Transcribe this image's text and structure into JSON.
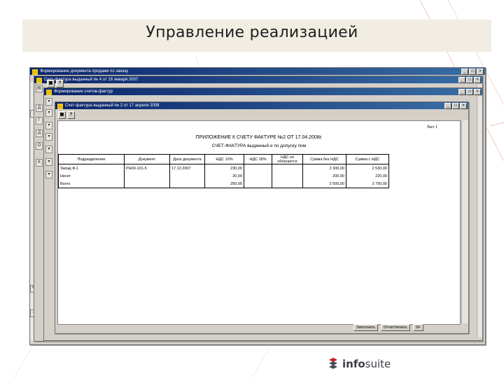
{
  "slide": {
    "title": "Управление реализацией"
  },
  "windows": {
    "back1_title": "Формирование документа продажи по заказу",
    "back2_title": "Счет-фактура выданный № 4 от 16 января 2007",
    "back3_title": "Формирование счетов-фактур",
    "front_title": "Счет-фактура выданный № 2 от 17 апреля 2008"
  },
  "window_controls": {
    "minimize": "_",
    "maximize": "□",
    "close": "×"
  },
  "toolbar": {
    "print_label": "▦",
    "help_label": "?"
  },
  "report": {
    "title_line1": "ПРИЛОЖЕНИЕ К СЧЕТУ ФАКТУРЕ №2 ОТ 17.04.2008г.",
    "title_line2": "СЧЕТ-ФАКТУРА выданный и по допуску пом",
    "page_label": "Лист 1",
    "headers": [
      "Подразделение",
      "Документ",
      "Дата документа",
      "НДС 10%",
      "НДС 18%",
      "НДС не облагается",
      "Сумма без НДС",
      "Сумма с НДС"
    ],
    "rows": [
      [
        "Запад Ф-1",
        "РН00-101-5",
        "17.12.2007",
        "230,00",
        "",
        "",
        "2 300,00",
        "2 530,00"
      ],
      [
        "Несет",
        "",
        "",
        "20,00",
        "",
        "",
        "200,00",
        "220,00"
      ],
      [
        "Всего",
        "",
        "",
        "250,00",
        "",
        "",
        "2 500,00",
        "2 750,00"
      ]
    ]
  },
  "status_bar": {
    "fill_label": "Заполнить",
    "print_label": "Отчет/печать",
    "extra": "SF"
  },
  "logo": {
    "name_bold": "info",
    "name_regular": "suite"
  },
  "colors": {
    "titlebar_start": "#0a246a",
    "titlebar_end": "#3a6ea5",
    "window_face": "#d4d0c8",
    "banner": "#f1ede3",
    "logo_red": "#c8202b"
  }
}
